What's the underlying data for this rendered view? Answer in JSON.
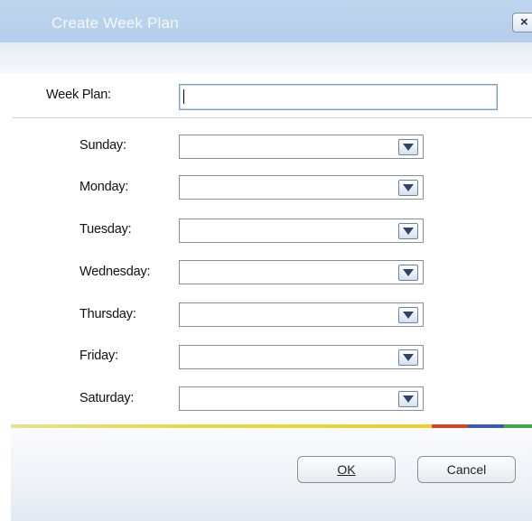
{
  "dialog": {
    "title": "Create Week Plan",
    "close_glyph": "×"
  },
  "form": {
    "week_plan_label": "Week Plan:",
    "week_plan_value": "",
    "days": [
      {
        "label": "Sunday:",
        "value": ""
      },
      {
        "label": "Monday:",
        "value": ""
      },
      {
        "label": "Tuesday:",
        "value": ""
      },
      {
        "label": "Wednesday:",
        "value": ""
      },
      {
        "label": "Thursday:",
        "value": ""
      },
      {
        "label": "Friday:",
        "value": ""
      },
      {
        "label": "Saturday:",
        "value": ""
      }
    ]
  },
  "buttons": {
    "ok_label": "OK",
    "cancel_label": "Cancel"
  },
  "colors": {
    "titlebar": "#bfd6ef",
    "stripe_yellow": "#e8d94a",
    "stripe_red": "#d2452d",
    "stripe_blue": "#3f58b6",
    "stripe_green": "#3ea84a"
  },
  "icons": {
    "combo_arrow": "chevron-down-icon",
    "close": "close-icon"
  }
}
